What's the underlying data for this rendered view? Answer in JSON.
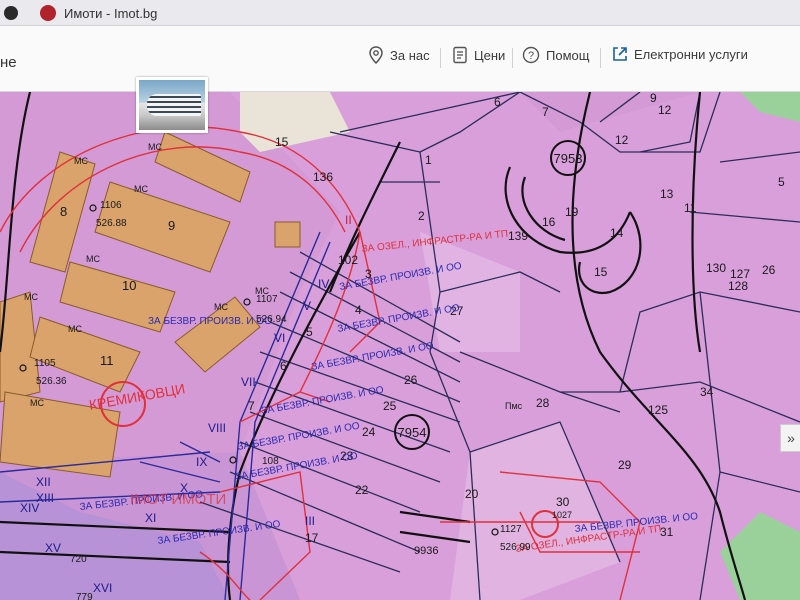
{
  "tab": {
    "title": "Имоти - Imot.bg"
  },
  "nav": {
    "left_fragment": "не",
    "about": "За нас",
    "prices": "Цени",
    "help": "Помощ",
    "eservices": "Електронни услуги"
  },
  "map": {
    "parcels": [
      "1",
      "2",
      "3",
      "4",
      "5",
      "6",
      "7",
      "8",
      "9",
      "10",
      "11",
      "12",
      "13",
      "14",
      "15",
      "16",
      "17",
      "19",
      "20",
      "22",
      "23",
      "24",
      "25",
      "26",
      "27",
      "28",
      "29",
      "30",
      "31",
      "34",
      "125",
      "127",
      "128",
      "130",
      "136",
      "139",
      "4",
      "3",
      "102"
    ],
    "blocks": [
      "7953",
      "7954"
    ],
    "roman": [
      "II",
      "III",
      "IV",
      "V",
      "VI",
      "VII",
      "VIII",
      "IX",
      "X",
      "XI",
      "XII",
      "XIII",
      "XIV",
      "XV",
      "XVI"
    ],
    "labels": {
      "zone_purpose": "ЗА БЕЗВР. ПРОИЗВ. И ОО",
      "infra": "ЗА ОЗЕЛ., ИНФРАСТР-РА И ТП",
      "district": "КРЕМИКОВЦИ",
      "watermark": "IMOT ИМОТИ",
      "ms": "МС",
      "pms": "Пмс",
      "point_1106": "1106",
      "elev_1106": "526.88",
      "point_1105": "1105",
      "elev_1105": "526.36",
      "point_1107": "1107",
      "elev_1107": "526.94",
      "point_1108": "108",
      "point_1127": "1127",
      "elev_1127": "526.99",
      "num_9936": "9936",
      "num_720": "720",
      "num_779": "779",
      "num_1027": "1027"
    }
  },
  "colors": {
    "map_bg": "#d49ad6",
    "building": "#d9a36b",
    "road_blue": "#2a2a7a",
    "boundary_red": "#e0303a"
  }
}
